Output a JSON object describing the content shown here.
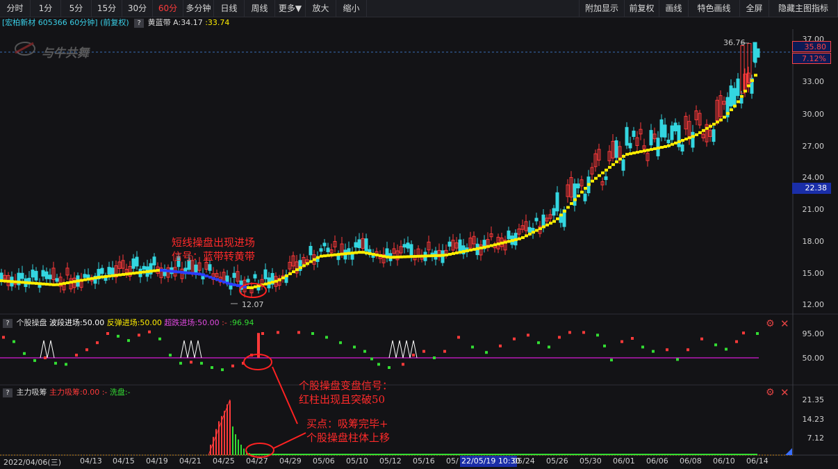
{
  "toolbar": {
    "left_items": [
      "分时",
      "1分",
      "5分",
      "15分",
      "30分",
      "60分",
      "多分钟",
      "日线",
      "周线",
      "更多▼",
      "放大",
      "缩小"
    ],
    "active": "60分",
    "right_items": [
      "附加显示",
      "前复权",
      "画线",
      "特色画线",
      "全屏",
      "隐藏主图指标"
    ]
  },
  "main_panel": {
    "title": "[宏柏新材 605366 60分钟]",
    "adjust": "(前复权)",
    "help": "?",
    "indicator_label": "黄蓝带",
    "indicator_a": "A:34.17",
    "indicator_b": ":33.74",
    "watermark": "与牛共舞",
    "y_ticks": [
      "37.00",
      "33.00",
      "30.00",
      "27.00",
      "24.00",
      "21.00",
      "18.00",
      "15.00",
      "12.00"
    ],
    "high_label": "36.76",
    "low_label": "12.07",
    "price_current": "35.80",
    "pct_change": "7.12%",
    "crosshair_price": "22.38"
  },
  "panel2": {
    "help": "?",
    "name": "个股操盘",
    "wave": "波段进场:50.00",
    "rebound": "反弹进场:50.00",
    "oversold": "超跌进场:50.00",
    "sep": ":-",
    "value": ":96.94",
    "y_ticks": [
      "95.00",
      "50.00"
    ]
  },
  "panel3": {
    "help": "?",
    "name": "主力吸筹",
    "accumulate": "主力吸筹:0.00",
    "sep": ":-",
    "wash": "洗盘:-",
    "y_ticks": [
      "21.35",
      "14.23",
      "7.12"
    ]
  },
  "x_axis": {
    "labels": [
      "2022/04/06(三)",
      "04/13",
      "04/15",
      "04/19",
      "04/21",
      "04/25",
      "04/27",
      "04/29",
      "05/06",
      "05/10",
      "05/12",
      "05/16",
      "05/",
      "05/24",
      "05/26",
      "05/30",
      "06/01",
      "06/06",
      "06/08",
      "06/10",
      "06/14"
    ],
    "cursor_label": "22/05/19 10:30"
  },
  "annotations": {
    "entry_signal": [
      "短线操盘出现进场",
      "信号：蓝带转黄带"
    ],
    "change_signal": [
      "个股操盘变盘信号：",
      "红柱出现且突破50"
    ],
    "buy_point": [
      "买点：吸筹完毕+",
      "个股操盘柱体上移"
    ]
  },
  "colors": {
    "up": "#ff3a3a",
    "down": "#33d6e0",
    "yellow_band": "#ffee00",
    "blue_band": "#2b3dff",
    "magenta_line": "#d61ad6",
    "green": "#33dd33",
    "annotation": "#ff2222",
    "cursor_bg": "#1a2ea8"
  }
}
